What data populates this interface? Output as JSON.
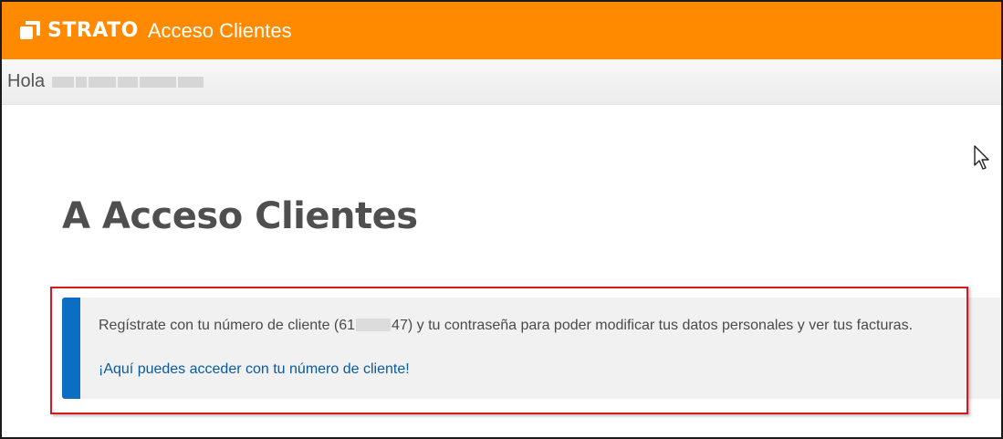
{
  "header": {
    "brand": "STRATO",
    "section_title": "Acceso Clientes",
    "background_color": "#ff8a00"
  },
  "greeting": {
    "label": "Hola",
    "user_name_redacted": true
  },
  "main": {
    "page_title": "A Acceso Clientes",
    "info": {
      "text_before": "Regístrate con tu número de cliente (61",
      "text_after": "47) y tu contraseña para poder modificar tus datos personales y ver tus facturas.",
      "link_label": "¡Aquí puedes acceder con tu número de cliente!",
      "accent_color": "#0a6fc2",
      "link_color": "#0a5aa0"
    }
  },
  "annotation": {
    "highlight_color": "#d8181c"
  },
  "icons": {
    "logo": "strato-logo-icon",
    "cursor": "mouse-pointer-icon"
  }
}
